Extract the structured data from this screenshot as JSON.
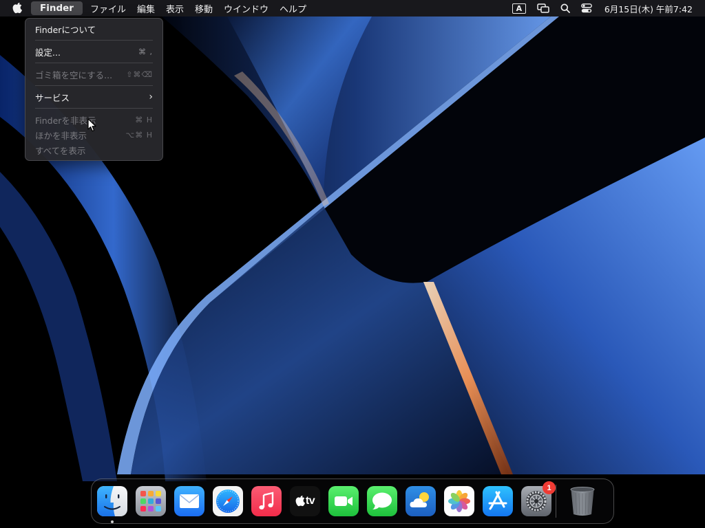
{
  "menubar": {
    "apple_icon": "apple-icon",
    "app_name": "Finder",
    "menus": [
      "ファイル",
      "編集",
      "表示",
      "移動",
      "ウインドウ",
      "ヘルプ"
    ],
    "input_source": "A",
    "status_icons": [
      "screen-mirroring-icon",
      "search-icon",
      "control-center-icon"
    ],
    "clock": "6月15日(木) 午前7:42"
  },
  "finder_menu": {
    "about": "Finderについて",
    "settings": "設定...",
    "settings_shortcut": "⌘ ,",
    "empty_trash": "ゴミ箱を空にする...",
    "empty_trash_shortcut": "⇧⌘⌫",
    "services": "サービス",
    "hide_finder": "Finderを非表示",
    "hide_finder_shortcut": "⌘ H",
    "hide_others": "ほかを非表示",
    "hide_others_shortcut": "⌥⌘ H",
    "show_all": "すべてを表示"
  },
  "dock": {
    "apps": [
      {
        "name": "Finder",
        "icon": "finder-icon",
        "running": true
      },
      {
        "name": "Launchpad",
        "icon": "launchpad-icon"
      },
      {
        "name": "Mail",
        "icon": "mail-icon"
      },
      {
        "name": "Safari",
        "icon": "safari-icon"
      },
      {
        "name": "Music",
        "icon": "music-icon"
      },
      {
        "name": "TV",
        "icon": "tv-icon",
        "label": "tv"
      },
      {
        "name": "FaceTime",
        "icon": "facetime-icon"
      },
      {
        "name": "Messages",
        "icon": "messages-icon"
      },
      {
        "name": "Weather",
        "icon": "weather-icon"
      },
      {
        "name": "Photos",
        "icon": "photos-icon"
      },
      {
        "name": "App Store",
        "icon": "app-store-icon"
      },
      {
        "name": "System Settings",
        "icon": "system-settings-icon",
        "badge": "1"
      }
    ],
    "trash_icon": "trash-icon"
  },
  "colors": {
    "menubar_bg": "#1a1a1e",
    "menu_bg": "#28282c",
    "badge_red": "#ef3b34",
    "wallpaper_blue": "#2f63c7"
  }
}
